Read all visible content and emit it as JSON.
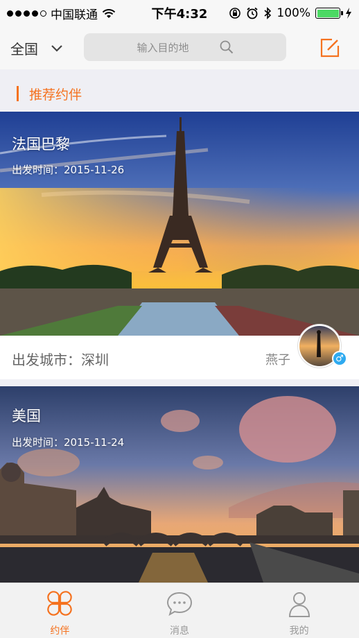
{
  "status_bar": {
    "carrier": "中国联通",
    "time": "下午4:32",
    "battery": "100%"
  },
  "nav": {
    "city": "全国",
    "search_placeholder": "输入目的地"
  },
  "section": {
    "title": "推荐约伴"
  },
  "cards": [
    {
      "title": "法国巴黎",
      "date_label": "出发时间：",
      "date": "2015-11-26",
      "depart_label": "出发城市：",
      "depart_city": "深圳",
      "user": "燕子",
      "gender_icon": "male-icon"
    },
    {
      "title": "美国",
      "date_label": "出发时间：",
      "date": "2015-11-24"
    }
  ],
  "tabs": [
    {
      "label": "约伴",
      "icon": "clover-icon",
      "active": true
    },
    {
      "label": "消息",
      "icon": "chat-bubble-icon",
      "active": false
    },
    {
      "label": "我的",
      "icon": "person-icon",
      "active": false
    }
  ],
  "colors": {
    "accent": "#f5721f",
    "gender_badge": "#2eaaf0",
    "battery": "#4cd964"
  }
}
